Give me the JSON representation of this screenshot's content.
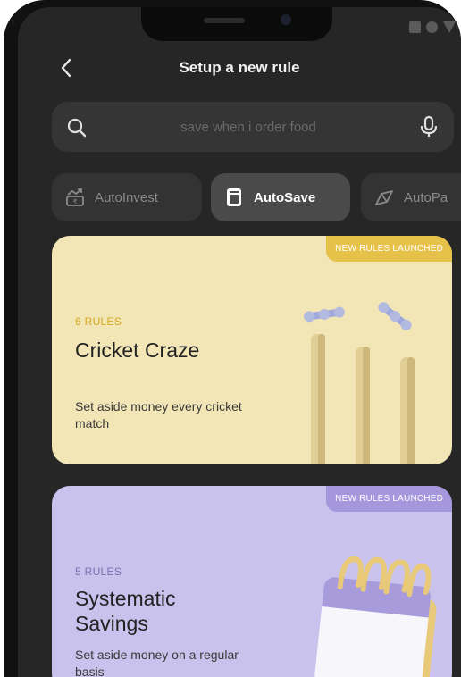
{
  "app": {
    "title": "Setup a new rule"
  },
  "search": {
    "placeholder": "save when i order food",
    "value": ""
  },
  "tabs": [
    {
      "label": "AutoInvest",
      "icon": "growth-chart-icon",
      "selected": false
    },
    {
      "label": "AutoSave",
      "icon": "jar-icon",
      "selected": true
    },
    {
      "label": "AutoPa",
      "icon": "payment-icon",
      "selected": false
    }
  ],
  "cards": [
    {
      "badge": "NEW RULES LAUNCHED",
      "count": "6 RULES",
      "title": "Cricket Craze",
      "description": "Set aside money every cricket match",
      "illustration": "cricket-wickets",
      "background": "#f2e5b6",
      "accent": "#e6c24a"
    },
    {
      "badge": "NEW RULES LAUNCHED",
      "count": "5 RULES",
      "title": "Systematic Savings",
      "description": "Set aside money on a regular basis",
      "illustration": "calendar",
      "background": "#c9c2ec",
      "accent": "#a597db"
    }
  ],
  "colors": {
    "screen": "#262626",
    "surface": "#353535",
    "selected_tab": "#4a4a4a"
  }
}
